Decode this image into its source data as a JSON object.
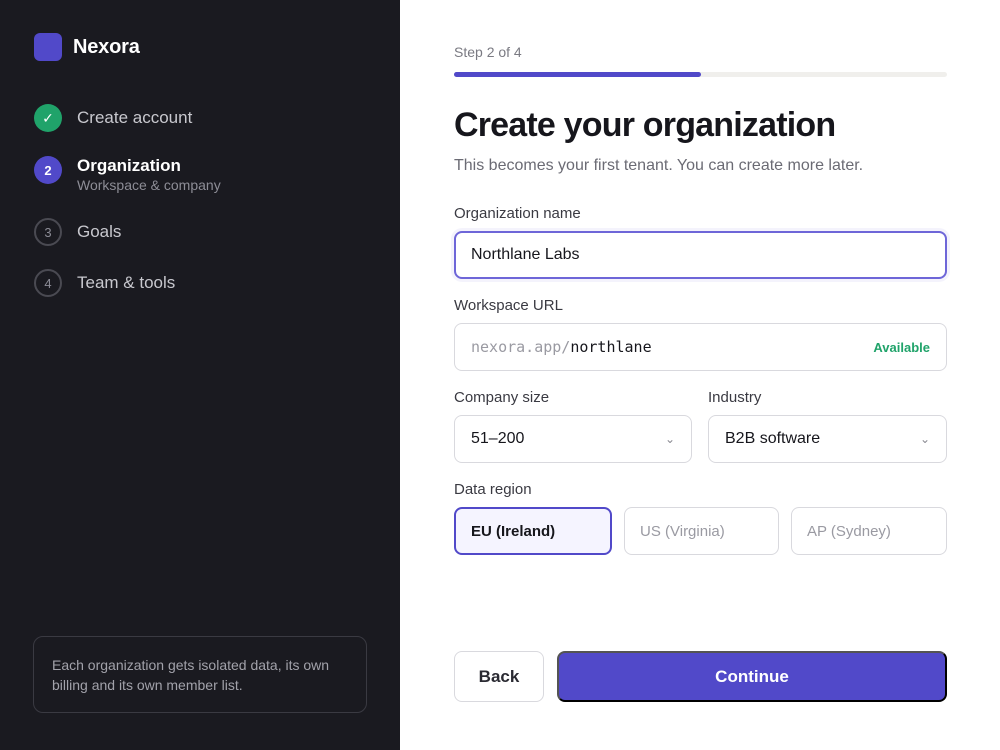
{
  "brand": {
    "name": "Nexora"
  },
  "steps": [
    {
      "number": "✓",
      "label": "Create account",
      "state": "done"
    },
    {
      "number": "2",
      "label": "Organization",
      "sublabel": "Workspace & company",
      "state": "active"
    },
    {
      "number": "3",
      "label": "Goals",
      "state": "todo"
    },
    {
      "number": "4",
      "label": "Team & tools",
      "state": "todo"
    }
  ],
  "info_box": {
    "text": "Each organization gets isolated data, its own billing and its own member list."
  },
  "progress": {
    "label": "Step 2 of 4",
    "fraction": 0.5
  },
  "header": {
    "title": "Create your organization",
    "subtitle": "This becomes your first tenant. You can create more later."
  },
  "form": {
    "org_name": {
      "label": "Organization name",
      "value": "Northlane Labs"
    },
    "workspace_url": {
      "label": "Workspace URL",
      "prefix": "nexora.app/",
      "value": "northlane",
      "status": "Available"
    },
    "company_size": {
      "label": "Company size",
      "value": "51–200"
    },
    "industry": {
      "label": "Industry",
      "value": "B2B software"
    },
    "data_region": {
      "label": "Data region",
      "options": [
        "EU (Ireland)",
        "US (Virginia)",
        "AP (Sydney)"
      ],
      "selected": "EU (Ireland)"
    }
  },
  "buttons": {
    "back": "Back",
    "continue": "Continue"
  },
  "icons": {
    "check": "check-icon",
    "chevron": "chevron-down-icon"
  },
  "colors": {
    "accent": "#5149c9",
    "success": "#20a36a",
    "sidebar_bg": "#1a1a20"
  }
}
